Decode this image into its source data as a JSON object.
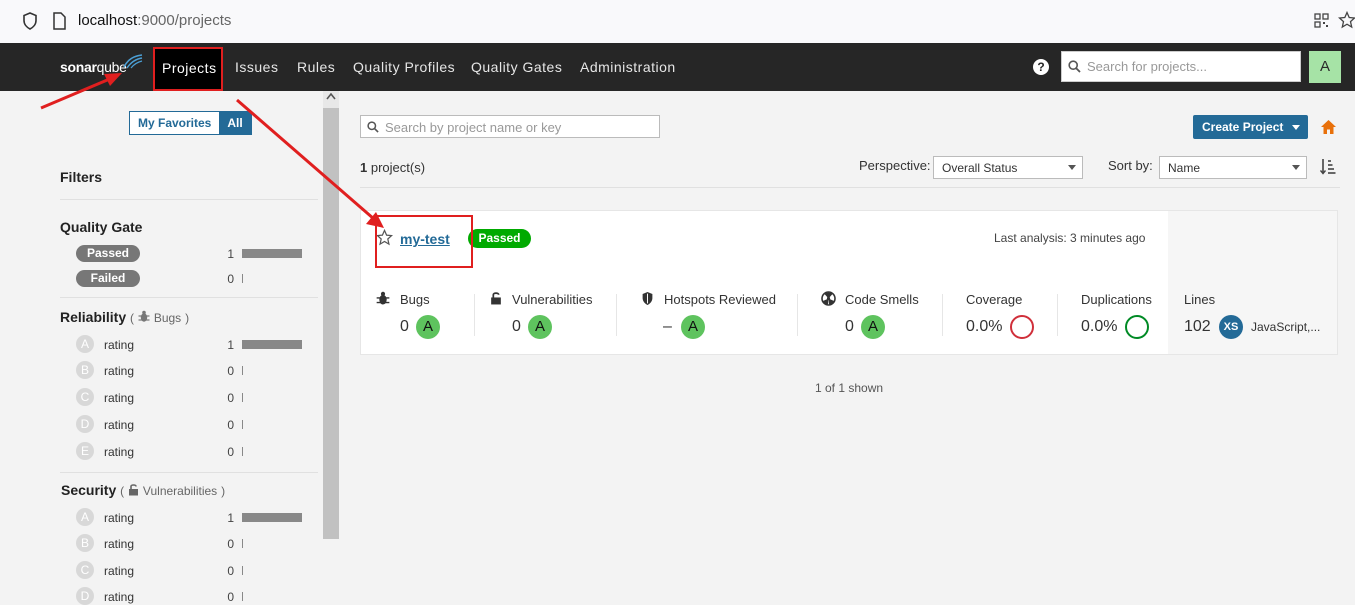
{
  "browser": {
    "url_host": "localhost",
    "url_port": ":9000/projects"
  },
  "nav": {
    "logo_bold": "sonar",
    "logo_light": "qube",
    "items": [
      "Projects",
      "Issues",
      "Rules",
      "Quality Profiles",
      "Quality Gates",
      "Administration"
    ],
    "help": "?",
    "search_placeholder": "Search for projects...",
    "avatar": "A"
  },
  "sidebar": {
    "toggle": {
      "favorites": "My Favorites",
      "all": "All"
    },
    "filters_title": "Filters",
    "quality_gate": {
      "title": "Quality Gate",
      "options": [
        {
          "label": "Passed",
          "count": "1",
          "fraction": 1
        },
        {
          "label": "Failed",
          "count": "0",
          "fraction": 0
        }
      ]
    },
    "reliability": {
      "title": "Reliability",
      "paren_open": "(",
      "sub": "Bugs",
      "paren_close": ")",
      "ratings": [
        {
          "letter": "A",
          "label": "rating",
          "count": "1",
          "fraction": 1
        },
        {
          "letter": "B",
          "label": "rating",
          "count": "0",
          "fraction": 0
        },
        {
          "letter": "C",
          "label": "rating",
          "count": "0",
          "fraction": 0
        },
        {
          "letter": "D",
          "label": "rating",
          "count": "0",
          "fraction": 0
        },
        {
          "letter": "E",
          "label": "rating",
          "count": "0",
          "fraction": 0
        }
      ]
    },
    "security": {
      "title": "Security",
      "paren_open": "(",
      "sub": "Vulnerabilities",
      "paren_close": ")",
      "ratings": [
        {
          "letter": "A",
          "label": "rating",
          "count": "1",
          "fraction": 1
        },
        {
          "letter": "B",
          "label": "rating",
          "count": "0",
          "fraction": 0
        },
        {
          "letter": "C",
          "label": "rating",
          "count": "0",
          "fraction": 0
        },
        {
          "letter": "D",
          "label": "rating",
          "count": "0",
          "fraction": 0
        }
      ]
    }
  },
  "main": {
    "search_placeholder": "Search by project name or key",
    "create_button": "Create Project",
    "count_number": "1",
    "count_suffix": " project(s)",
    "perspective_label": "Perspective:",
    "perspective_value": "Overall Status",
    "sort_label": "Sort by:",
    "sort_value": "Name",
    "footer": "1 of 1 shown"
  },
  "project": {
    "name": "my-test",
    "gate": "Passed",
    "last_analysis": "Last analysis: 3 minutes ago",
    "metrics": {
      "bugs": {
        "label": "Bugs",
        "value": "0",
        "grade": "A"
      },
      "vulnerabilities": {
        "label": "Vulnerabilities",
        "value": "0",
        "grade": "A"
      },
      "hotspots": {
        "label": "Hotspots Reviewed",
        "value": "–",
        "grade": "A"
      },
      "code_smells": {
        "label": "Code Smells",
        "value": "0",
        "grade": "A"
      },
      "coverage": {
        "label": "Coverage",
        "value": "0.0%"
      },
      "duplications": {
        "label": "Duplications",
        "value": "0.0%"
      },
      "lines": {
        "label": "Lines",
        "value": "102",
        "size": "XS",
        "languages": "JavaScript,..."
      }
    }
  },
  "colors": {
    "nav_bg": "#262626",
    "accent": "#236a97",
    "passed": "#00aa00",
    "grade_a": "#5ec35e",
    "annotation": "#e01f1f"
  }
}
